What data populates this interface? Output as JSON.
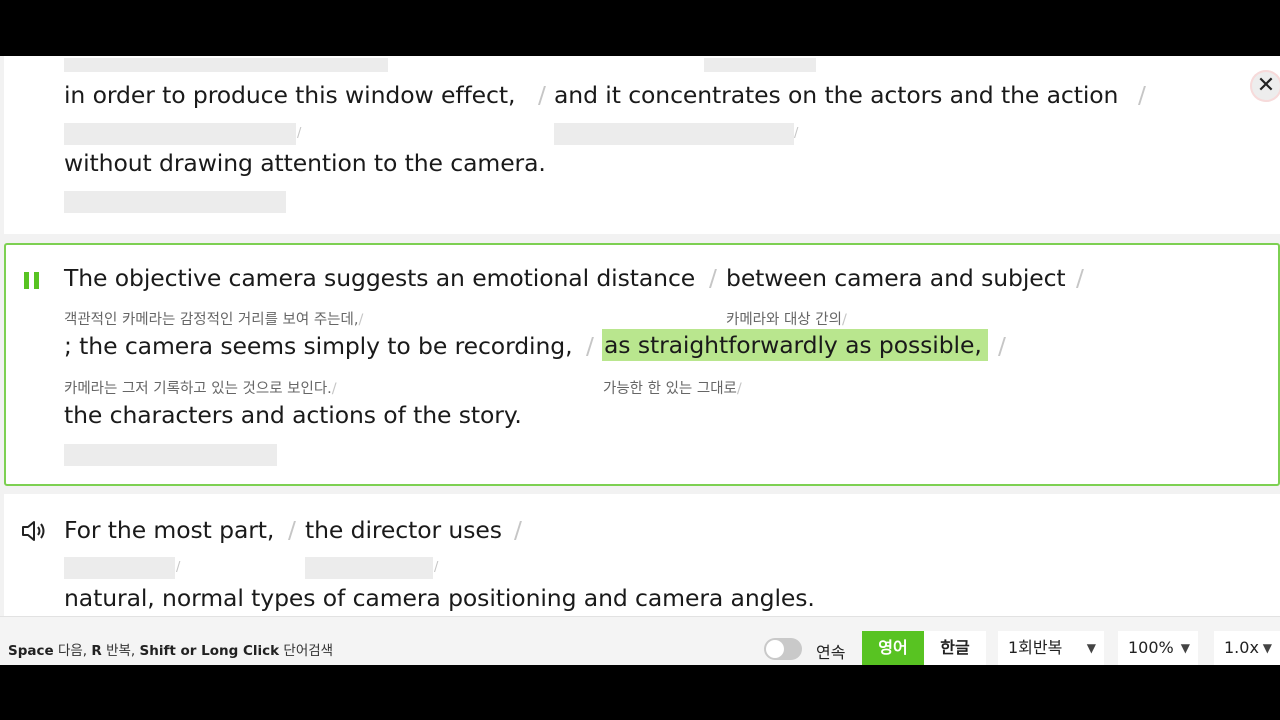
{
  "close_label": "✕",
  "card1": {
    "line1": {
      "a": "in order to produce this window effect,",
      "s1": "/",
      "b": "and it concentrates on the actors and the action",
      "s2": "/"
    },
    "line2": {
      "a": "without drawing attention to the camera."
    },
    "slash": "/"
  },
  "card2": {
    "line1": {
      "a": "The objective camera suggests an emotional distance",
      "s1": "/",
      "b": "between camera and subject",
      "s2": "/"
    },
    "kor1": {
      "a": "객관적인 카메라는 감정적인 거리를 보여 주는데,",
      "b": "카메라와 대상 간의"
    },
    "line2": {
      "a": "; the camera seems simply to be recording,",
      "s1": "/",
      "b": "as straightforwardly as possible,",
      "s2": "/"
    },
    "kor2": {
      "a": "카메라는 그저 기록하고 있는 것으로 보인다.",
      "b": "가능한 한 있는 그대로"
    },
    "line3": {
      "a": "the characters and actions of the story."
    },
    "slash": "/"
  },
  "card3": {
    "line1": {
      "a": "For the most part,",
      "s1": "/",
      "b": "the director uses",
      "s2": "/"
    },
    "line2": {
      "a": "natural, normal types of camera positioning and camera angles."
    },
    "slash": "/"
  },
  "footer": {
    "hint_k1": "Space",
    "hint_t1": " 다음, ",
    "hint_k2": "R",
    "hint_t2": " 반복, ",
    "hint_k3": "Shift or Long Click",
    "hint_t3": " 단어검색",
    "continuous_label": "연속",
    "english_btn": "영어",
    "korean_btn": "한글",
    "repeat_select": "1회반복",
    "zoom_select": "100%",
    "speed_select": "1.0x"
  },
  "colors": {
    "accent": "#58c322",
    "highlight": "#b9e68e",
    "border": "#7dd052"
  },
  "icons": {
    "pause": "pause-icon",
    "speaker": "speaker-icon",
    "close": "close-icon",
    "chevron": "chevron-down-icon"
  }
}
